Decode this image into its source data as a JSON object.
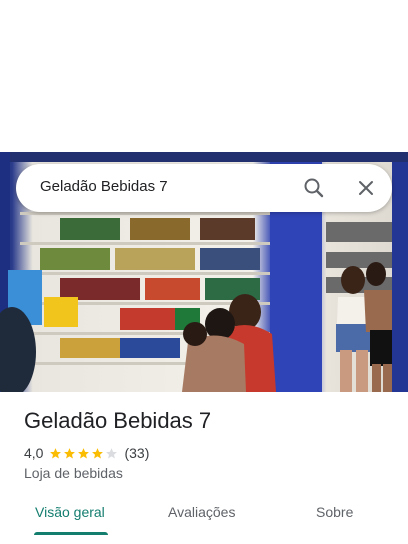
{
  "search": {
    "query": "Geladão Bebidas 7",
    "search_icon": "search-icon",
    "close_icon": "close-icon"
  },
  "place": {
    "name": "Geladão Bebidas 7",
    "rating": "4,0",
    "stars_filled": 4,
    "stars_total": 5,
    "review_count": "(33)",
    "category": "Loja de bebidas"
  },
  "tabs": [
    {
      "label": "Visão geral",
      "active": true
    },
    {
      "label": "Avaliações",
      "active": false
    },
    {
      "label": "Sobre",
      "active": false
    }
  ],
  "colors": {
    "accent": "#137d6e",
    "star": "#fbbc04",
    "star_empty": "#dadce0"
  }
}
